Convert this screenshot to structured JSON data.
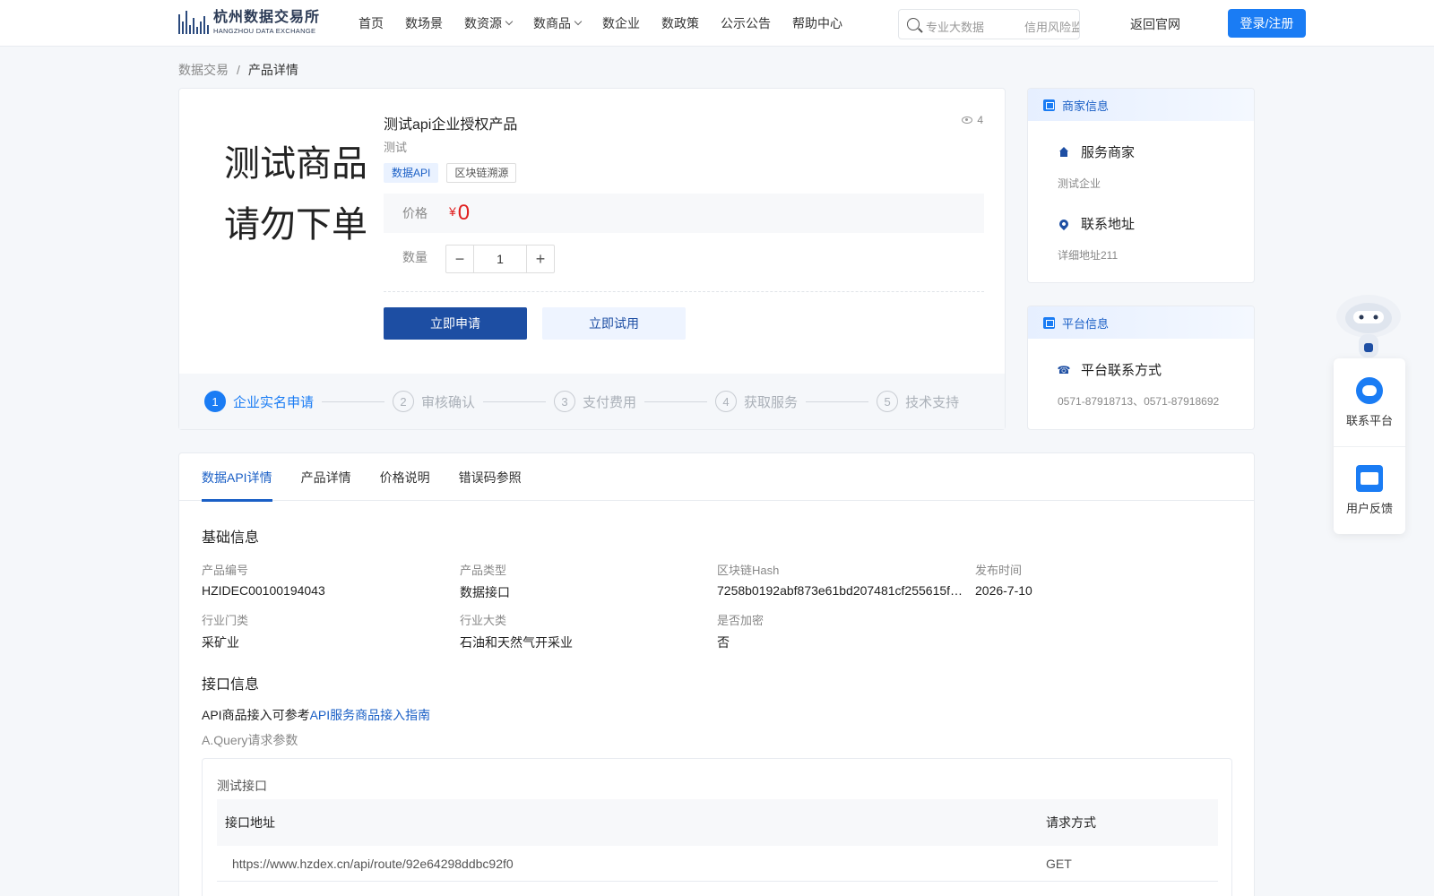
{
  "header": {
    "logo_cn": "杭州数据交易所",
    "logo_en": "HANGZHOU DATA EXCHANGE",
    "nav": [
      {
        "label": "首页",
        "dropdown": false
      },
      {
        "label": "数场景",
        "dropdown": false
      },
      {
        "label": "数资源",
        "dropdown": true
      },
      {
        "label": "数商品",
        "dropdown": true
      },
      {
        "label": "数企业",
        "dropdown": false
      },
      {
        "label": "数政策",
        "dropdown": false
      },
      {
        "label": "公示公告",
        "dropdown": false
      },
      {
        "label": "帮助中心",
        "dropdown": false
      }
    ],
    "search_placeholders": [
      "专业大数据",
      "信用风险监"
    ],
    "back_link": "返回官网",
    "login_label": "登录/注册"
  },
  "breadcrumb": {
    "root": "数据交易",
    "separator": "/",
    "current": "产品详情"
  },
  "product": {
    "cover_line1": "测试商品",
    "cover_line2": "请勿下单",
    "title": "测试api企业授权产品",
    "views": "4",
    "subtitle": "测试",
    "tags": [
      {
        "label": "数据API",
        "style": "blue"
      },
      {
        "label": "区块链溯源",
        "style": "plain"
      }
    ],
    "price_label": "价格",
    "price_currency": "¥",
    "price_value": "0",
    "quantity_label": "数量",
    "quantity_value": "1",
    "apply_button": "立即申请",
    "trial_button": "立即试用",
    "steps": [
      {
        "num": "1",
        "label": "企业实名申请",
        "active": true
      },
      {
        "num": "2",
        "label": "审核确认",
        "active": false
      },
      {
        "num": "3",
        "label": "支付费用",
        "active": false
      },
      {
        "num": "4",
        "label": "获取服务",
        "active": false
      },
      {
        "num": "5",
        "label": "技术支持",
        "active": false
      }
    ]
  },
  "merchant": {
    "header": "商家信息",
    "service_label": "服务商家",
    "service_value": "测试企业",
    "address_label": "联系地址",
    "address_value": "详细地址211"
  },
  "platform": {
    "header": "平台信息",
    "contact_label": "平台联系方式",
    "contact_value": "0571-87918713、0571-87918692"
  },
  "float_widget": {
    "contact": "联系平台",
    "feedback": "用户反馈"
  },
  "details": {
    "tabs": [
      "数据API详情",
      "产品详情",
      "价格说明",
      "错误码参照"
    ],
    "active_tab": 0,
    "basic_title": "基础信息",
    "fields": [
      {
        "key": "产品编号",
        "value": "HZIDEC00100194043"
      },
      {
        "key": "产品类型",
        "value": "数据接口"
      },
      {
        "key": "区块链Hash",
        "value": "7258b0192abf873e61bd207481cf255615f…"
      },
      {
        "key": "发布时间",
        "value": "2026-7-10"
      },
      {
        "key": "行业门类",
        "value": "采矿业"
      },
      {
        "key": "行业大类",
        "value": "石油和天然气开采业"
      },
      {
        "key": "是否加密",
        "value": "否"
      }
    ],
    "api_title": "接口信息",
    "api_note_prefix": "API商品接入可参考",
    "api_note_link": "API服务商品接入指南",
    "query_label": "A.Query请求参数",
    "api_box_title": "测试接口",
    "api_table": {
      "col_url": "接口地址",
      "col_method": "请求方式",
      "rows": [
        {
          "url": "https://www.hzdex.cn/api/route/92e64298ddbc92f0",
          "method": "GET"
        }
      ]
    }
  },
  "colors": {
    "primary": "#1a7cf4",
    "navy": "#1d4ea3",
    "price": "#e02020"
  }
}
